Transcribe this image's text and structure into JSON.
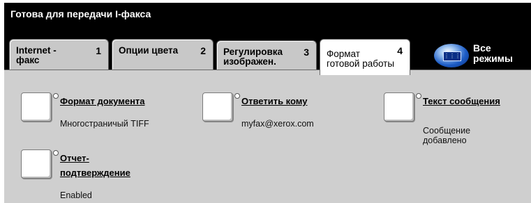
{
  "status": {
    "text": "Готова для передачи I-факса"
  },
  "tabs": [
    {
      "line1": "Internet -",
      "line2": "факс",
      "number": "1"
    },
    {
      "line1": "Опции цвета",
      "line2": "",
      "number": "2"
    },
    {
      "line1": "Регулировка",
      "line2": "изображен.",
      "number": "3"
    },
    {
      "line1": "Формат",
      "line2": "готовой работы",
      "number": "4",
      "selected": true
    }
  ],
  "all_modes": {
    "line1": "Все",
    "line2": "режимы",
    "icon": "all-services-icon"
  },
  "features": {
    "format": {
      "title": "Формат документа",
      "value": "Многостраничый TIFF"
    },
    "reply": {
      "title": "Ответить кому",
      "value": "myfax@xerox.com"
    },
    "message": {
      "title": "Текст сообщения",
      "value_line1": "Сообщение",
      "value_line2": "добавлено"
    },
    "report": {
      "title_line1": "Отчет-",
      "title_line2": "подтверждение",
      "value": "Enabled"
    }
  },
  "colors": {
    "status_bg": "#000000",
    "panel_bg": "#cfcfcf",
    "tab_bg": "#c8c8c8",
    "selected_tab_bg": "#ffffff",
    "icon_blue": "#1c5cc6"
  }
}
